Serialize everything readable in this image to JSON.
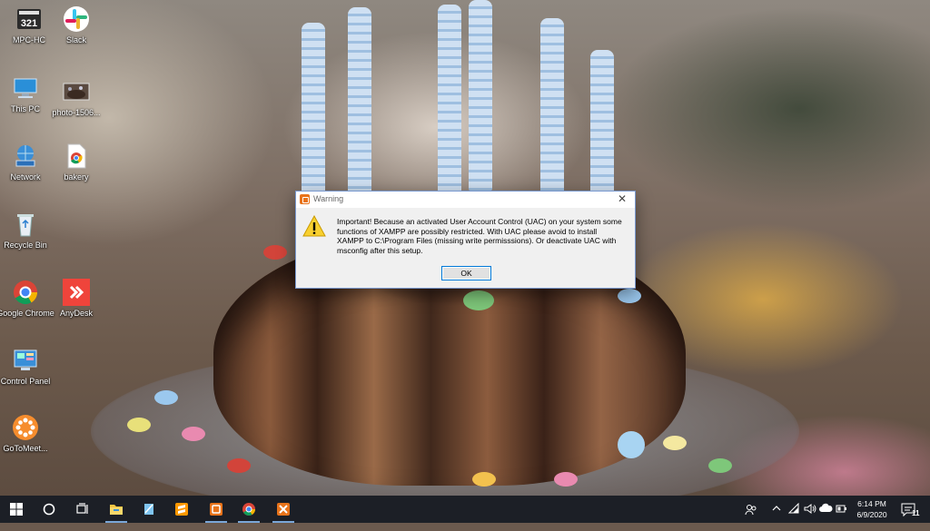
{
  "desktop": {
    "icons": [
      {
        "label": "MPC-HC",
        "icon": "mpc-hc-icon"
      },
      {
        "label": "Slack",
        "icon": "slack-icon"
      },
      {
        "label": "This PC",
        "icon": "this-pc-icon"
      },
      {
        "label": "photo-1506...",
        "icon": "photo-thumbnail-icon"
      },
      {
        "label": "Network",
        "icon": "network-icon"
      },
      {
        "label": "bakery",
        "icon": "chrome-file-icon"
      },
      {
        "label": "Recycle Bin",
        "icon": "recycle-bin-icon"
      },
      {
        "label": "Google Chrome",
        "icon": "chrome-icon"
      },
      {
        "label": "AnyDesk",
        "icon": "anydesk-icon"
      },
      {
        "label": "Control Panel",
        "icon": "control-panel-icon"
      },
      {
        "label": "GoToMeet...",
        "icon": "gotomeeting-icon"
      }
    ]
  },
  "dialog": {
    "title": "Warning",
    "close_glyph": "✕",
    "icon": "warning-icon",
    "message": "Important! Because an activated User Account Control (UAC) on your system some functions of XAMPP are possibly restricted. With UAC please avoid to install XAMPP to C:\\Program Files (missing write permisssions). Or deactivate UAC with msconfig after this setup.",
    "ok_label": "OK"
  },
  "taskbar": {
    "items": [
      "start-icon",
      "cortana-search-icon",
      "task-view-icon",
      "file-explorer-icon",
      "notepad-icon",
      "sublime-text-icon",
      "xampp-icon",
      "chrome-icon",
      "xampp-installer-icon"
    ],
    "tray": [
      "people-icon",
      "chevron-up-icon",
      "network-icon",
      "volume-icon",
      "cloud-icon",
      "battery-icon",
      "keyboard-icon"
    ],
    "time": "6:14 PM",
    "date": "6/9/2020",
    "notification_count": "11"
  },
  "colors": {
    "taskbar_bg": "#1c1f26",
    "accent": "#0078d7",
    "xampp_orange": "#e8731a"
  }
}
